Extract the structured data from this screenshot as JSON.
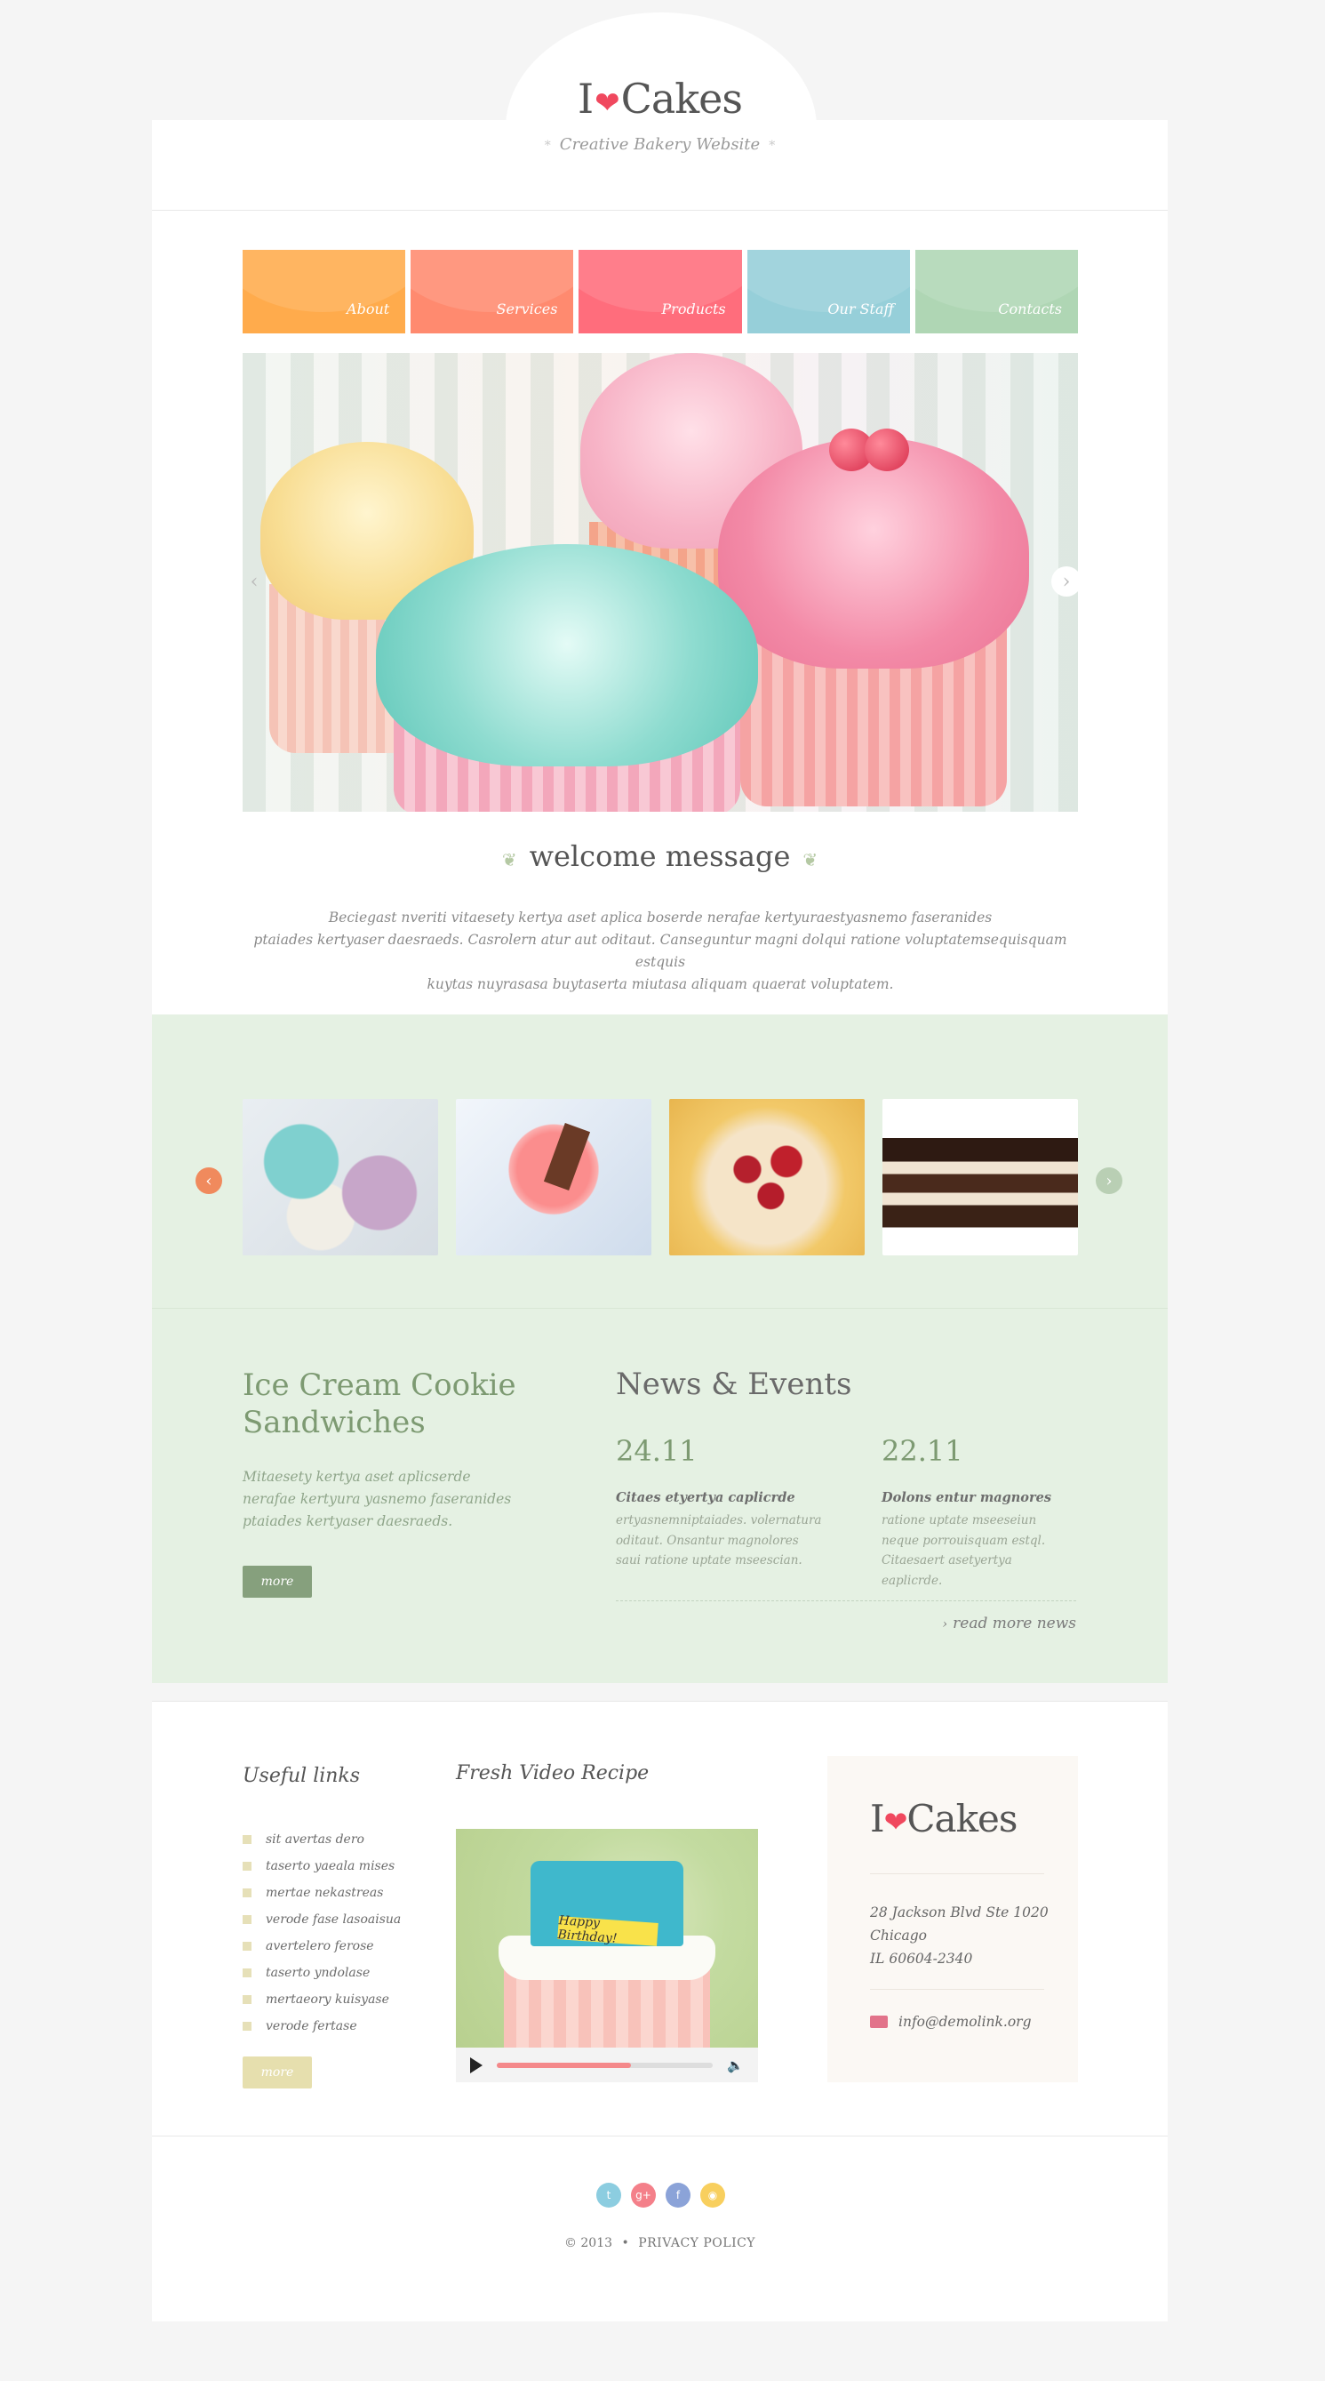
{
  "brand": {
    "prefix": "I",
    "heart": "❤",
    "name": "Cakes",
    "tagline": "Creative Bakery Website",
    "tag_star": "*"
  },
  "nav": [
    {
      "label": "About",
      "color": "#ffab4c"
    },
    {
      "label": "Services",
      "color": "#ff8a6f"
    },
    {
      "label": "Products",
      "color": "#ff6d7c"
    },
    {
      "label": "Our Staff",
      "color": "#96cfd9"
    },
    {
      "label": "Contacts",
      "color": "#afd6b4"
    }
  ],
  "slider": {
    "prev_icon": "chevron-left-icon",
    "next_icon": "chevron-right-icon"
  },
  "welcome": {
    "title": "welcome message",
    "text_lines": [
      "Beciegast nveriti vitaesety kertya aset aplica boserde nerafae kertyuraestyasnemo faseranides",
      "ptaiades kertyaser daesraeds. Casrolern atur aut oditaut. Canseguntur magni dolqui ratione voluptatemsequisquam estquis",
      "kuytas nuyrasasa buytaserta miutasa aliquam quaerat voluptatem."
    ]
  },
  "gallery": {
    "items": [
      "macarons",
      "cupcake",
      "cherry cake",
      "chocolate cake"
    ],
    "prev_color": "#f08a5d",
    "next_color": "#b9cfb4"
  },
  "feature": {
    "title": "Ice Cream Cookie Sandwiches",
    "text": "Mitaesety kertya aset aplicserde nerafae kertyura yasnemo faseranides ptaiades kertyaser daesraeds.",
    "button": "more"
  },
  "news": {
    "title": "News & Events",
    "items": [
      {
        "date": "24.11",
        "headline": "Citaes etyertya caplicrde",
        "body": "ertyasnemniptaiades. volernatura oditaut. Onsantur magnolores saui ratione uptate mseescian."
      },
      {
        "date": "22.11",
        "headline": "Dolons entur magnores",
        "body": "ratione uptate mseeseiun neque porrouisquam estql. Citaesaert asetyertya eaplicrde."
      }
    ],
    "read_more": "read more news",
    "read_more_icon": "›"
  },
  "useful_links": {
    "title": "Useful links",
    "items": [
      "sit avertas dero",
      "taserto yaeala mises",
      "mertae nekastreas",
      "verode fase lasoaisua",
      "avertelero ferose",
      "taserto yndolase",
      "mertaeory kuisyase",
      "verode fertase"
    ],
    "button": "more"
  },
  "video": {
    "title": "Fresh Video Recipe",
    "cake_text": "Happy Birthday!",
    "progress": 0.62
  },
  "contact": {
    "address_lines": [
      "28 Jackson Blvd Ste 1020",
      "Chicago",
      "IL 60604-2340"
    ],
    "email": "info@demolink.org"
  },
  "social": [
    {
      "name": "twitter-icon",
      "glyph": "t",
      "color": "#8ccde0"
    },
    {
      "name": "google-plus-icon",
      "glyph": "g+",
      "color": "#f4808a"
    },
    {
      "name": "facebook-icon",
      "glyph": "f",
      "color": "#8ba3d8"
    },
    {
      "name": "rss-icon",
      "glyph": "◉",
      "color": "#f8cf5e"
    }
  ],
  "footer": {
    "copyright": "© 2013",
    "sep": "•",
    "privacy": "PRIVACY POLICY"
  }
}
